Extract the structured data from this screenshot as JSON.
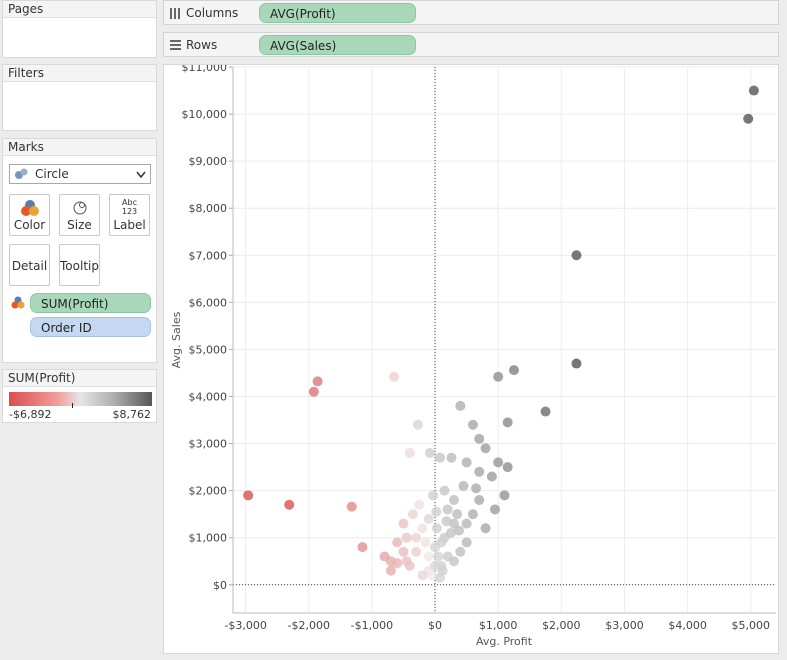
{
  "pages": {
    "title": "Pages"
  },
  "filters": {
    "title": "Filters"
  },
  "marks": {
    "title": "Marks",
    "mark_type": "Circle",
    "buttons": {
      "color": "Color",
      "size": "Size",
      "label": "Label",
      "label_icon": "Abc 123",
      "detail": "Detail",
      "tooltip": "Tooltip"
    },
    "fields": {
      "color_field": "SUM(Profit)",
      "detail_field": "Order ID"
    }
  },
  "legend": {
    "title": "SUM(Profit)",
    "min": "-$6,892",
    "max": "$8,762",
    "colors": {
      "low": "#d94f4f",
      "mid": "#f2f2f2",
      "high": "#555555"
    }
  },
  "shelves": {
    "columns": {
      "label": "Columns",
      "pill": "AVG(Profit)"
    },
    "rows": {
      "label": "Rows",
      "pill": "AVG(Sales)"
    }
  },
  "chart_data": {
    "type": "scatter",
    "xlabel": "Avg. Profit",
    "ylabel": "Avg. Sales",
    "xlim": [
      -3200,
      5400
    ],
    "ylim": [
      -600,
      11000
    ],
    "xticks": [
      -3000,
      -2000,
      -1000,
      0,
      1000,
      2000,
      3000,
      4000,
      5000
    ],
    "xtick_labels": [
      "-$3,000",
      "-$2,000",
      "-$1,000",
      "$0",
      "$1,000",
      "$2,000",
      "$3,000",
      "$4,000",
      "$5,000"
    ],
    "yticks": [
      0,
      1000,
      2000,
      3000,
      4000,
      5000,
      6000,
      7000,
      8000,
      9000,
      10000,
      11000
    ],
    "ytick_labels": [
      "$0",
      "$1,000",
      "$2,000",
      "$3,000",
      "$4,000",
      "$5,000",
      "$6,000",
      "$7,000",
      "$8,000",
      "$9,000",
      "$10,000",
      "$11,000"
    ],
    "grid": true,
    "points": [
      [
        5050,
        10500
      ],
      [
        4960,
        9900
      ],
      [
        2240,
        7000
      ],
      [
        2240,
        4700
      ],
      [
        1750,
        3680
      ],
      [
        1150,
        3450
      ],
      [
        1150,
        2500
      ],
      [
        1250,
        4560
      ],
      [
        1000,
        4420
      ],
      [
        -650,
        4420
      ],
      [
        -1860,
        4320
      ],
      [
        -1920,
        4100
      ],
      [
        -270,
        3400
      ],
      [
        -2960,
        1900
      ],
      [
        -2310,
        1700
      ],
      [
        -1320,
        1660
      ],
      [
        -1150,
        800
      ],
      [
        -700,
        500
      ],
      [
        -600,
        460
      ],
      [
        -450,
        1000
      ],
      [
        -350,
        1500
      ],
      [
        -250,
        1700
      ],
      [
        -400,
        2800
      ],
      [
        400,
        3800
      ],
      [
        600,
        3400
      ],
      [
        700,
        3100
      ],
      [
        800,
        2900
      ],
      [
        500,
        2600
      ],
      [
        900,
        2300
      ],
      [
        1000,
        2600
      ],
      [
        1100,
        1900
      ],
      [
        700,
        1800
      ],
      [
        300,
        1800
      ],
      [
        200,
        1600
      ],
      [
        600,
        1500
      ],
      [
        800,
        1200
      ],
      [
        300,
        1300
      ],
      [
        150,
        1000
      ],
      [
        500,
        900
      ],
      [
        400,
        700
      ],
      [
        200,
        600
      ],
      [
        100,
        400
      ],
      [
        -100,
        300
      ],
      [
        -200,
        200
      ],
      [
        -300,
        700
      ],
      [
        -150,
        900
      ],
      [
        -500,
        1300
      ],
      [
        -600,
        900
      ],
      [
        -800,
        600
      ],
      [
        -700,
        300
      ],
      [
        -400,
        400
      ],
      [
        -500,
        700
      ],
      [
        -200,
        1200
      ],
      [
        -100,
        1400
      ],
      [
        0,
        800
      ],
      [
        50,
        600
      ],
      [
        0,
        400
      ],
      [
        -50,
        200
      ],
      [
        80,
        150
      ],
      [
        30,
        1200
      ],
      [
        250,
        1100
      ],
      [
        350,
        1500
      ],
      [
        450,
        2100
      ],
      [
        150,
        2000
      ],
      [
        -80,
        2800
      ],
      [
        80,
        2700
      ],
      [
        260,
        2700
      ],
      [
        650,
        2050
      ],
      [
        300,
        500
      ],
      [
        500,
        1300
      ],
      [
        950,
        1600
      ],
      [
        700,
        2400
      ],
      [
        -300,
        1000
      ],
      [
        -450,
        500
      ],
      [
        -100,
        600
      ],
      [
        100,
        900
      ],
      [
        -30,
        1900
      ],
      [
        20,
        1550
      ],
      [
        180,
        1350
      ],
      [
        380,
        1150
      ],
      [
        120,
        300
      ]
    ]
  }
}
